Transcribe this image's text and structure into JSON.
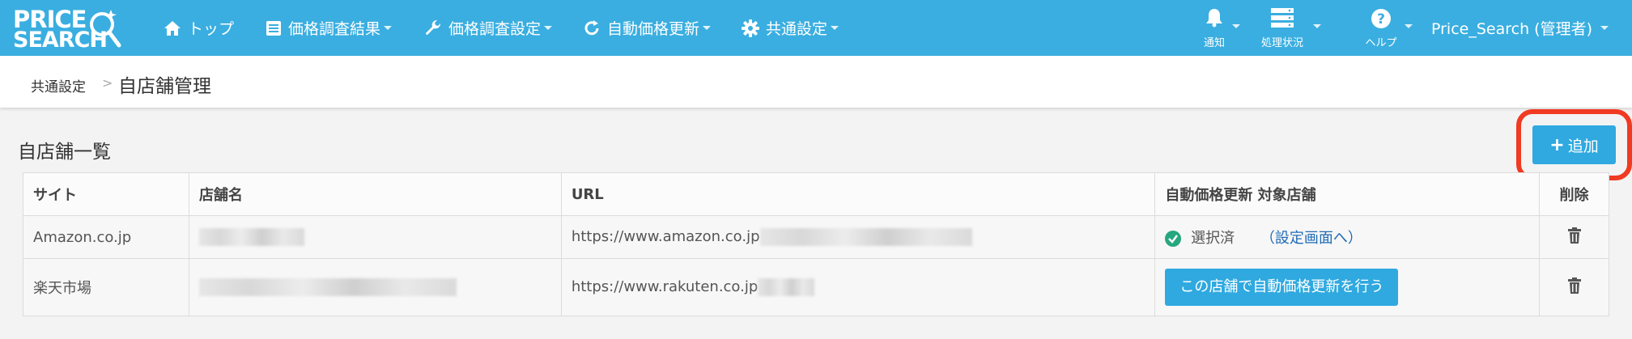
{
  "logo": {
    "line1": "PRICE",
    "line2": "SEARCH"
  },
  "nav": {
    "items": [
      {
        "label": "トップ",
        "icon": "home-icon"
      },
      {
        "label": "価格調査結果",
        "icon": "list-icon"
      },
      {
        "label": "価格調査設定",
        "icon": "wrench-icon"
      },
      {
        "label": "自動価格更新",
        "icon": "refresh-icon"
      },
      {
        "label": "共通設定",
        "icon": "gear-icon"
      }
    ],
    "right": [
      {
        "label": "通知",
        "icon": "bell-icon"
      },
      {
        "label": "処理状況",
        "icon": "server-icon"
      },
      {
        "label": "ヘルプ",
        "icon": "question-icon"
      }
    ],
    "user": "Price_Search (管理者)"
  },
  "breadcrumb": {
    "parent": "共通設定",
    "separator": ">",
    "current": "自店舗管理"
  },
  "section": {
    "title": "自店舗一覧",
    "add_label": "追加"
  },
  "table": {
    "headers": [
      "サイト",
      "店舗名",
      "URL",
      "自動価格更新 対象店舗",
      "削除"
    ],
    "rows": [
      {
        "site": "Amazon.co.jp",
        "url": "https://www.amazon.co.jp",
        "status": "選択済",
        "link": "（設定画面へ）"
      },
      {
        "site": "楽天市場",
        "url": "https://www.rakuten.co.jp",
        "button": "この店舗で自動価格更新を行う"
      }
    ]
  },
  "colors": {
    "navbar": "#3aaee0",
    "button": "#2fa9e0",
    "highlight": "#f03a22",
    "ok": "#26a77f"
  }
}
